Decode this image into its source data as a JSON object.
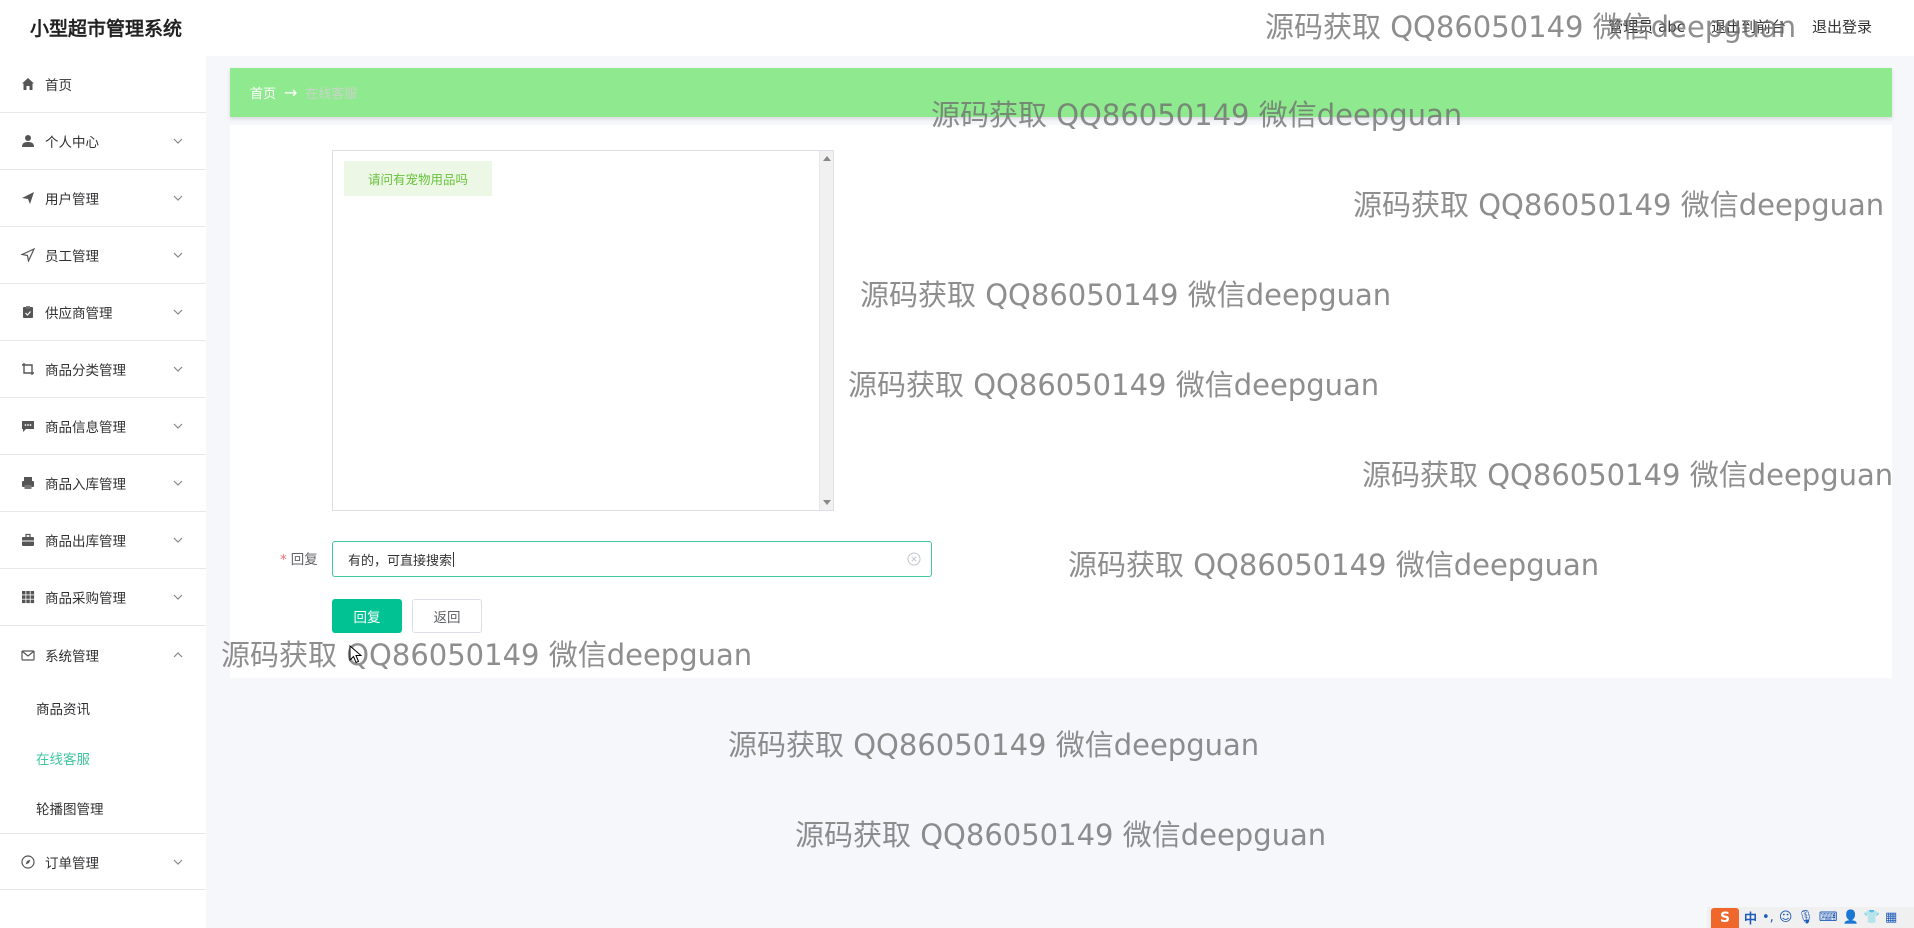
{
  "app": {
    "title": "小型超市管理系统"
  },
  "header": {
    "user_label": "管理员 abc",
    "back_to_front": "退出到前台",
    "logout": "退出登录"
  },
  "sidebar": {
    "items": [
      {
        "label": "首页",
        "icon": "home-icon",
        "has_children": false
      },
      {
        "label": "个人中心",
        "icon": "user-icon",
        "has_children": true
      },
      {
        "label": "用户管理",
        "icon": "send-icon",
        "has_children": true
      },
      {
        "label": "员工管理",
        "icon": "navigation-icon",
        "has_children": true
      },
      {
        "label": "供应商管理",
        "icon": "clipboard-icon",
        "has_children": true
      },
      {
        "label": "商品分类管理",
        "icon": "crop-icon",
        "has_children": true
      },
      {
        "label": "商品信息管理",
        "icon": "message-icon",
        "has_children": true
      },
      {
        "label": "商品入库管理",
        "icon": "printer-icon",
        "has_children": true
      },
      {
        "label": "商品出库管理",
        "icon": "briefcase-icon",
        "has_children": true
      },
      {
        "label": "商品采购管理",
        "icon": "grid-icon",
        "has_children": true
      },
      {
        "label": "系统管理",
        "icon": "mail-icon",
        "has_children": true,
        "expanded": true
      },
      {
        "label": "订单管理",
        "icon": "compass-icon",
        "has_children": true
      }
    ],
    "system_submenu": [
      {
        "label": "商品资讯",
        "active": false
      },
      {
        "label": "在线客服",
        "active": true
      },
      {
        "label": "轮播图管理",
        "active": false
      }
    ]
  },
  "breadcrumb": {
    "home": "首页",
    "arrow": "→",
    "current": "在线客服"
  },
  "chat": {
    "messages": [
      {
        "text": "请问有宠物用品吗"
      }
    ]
  },
  "form": {
    "reply_required_mark": "*",
    "reply_label": "回复",
    "reply_value": "有的，可直接搜索"
  },
  "buttons": {
    "reply": "回复",
    "back": "返回"
  },
  "watermark_text": "源码获取 QQ86050149 微信deepguan",
  "ime": {
    "logo": "S",
    "lang": "中"
  },
  "colors": {
    "accent": "#00c292",
    "active_menu": "#3fc79e",
    "breadcrumb_bg": "#8fe98f",
    "bubble_bg": "#edf7e6",
    "bubble_text": "#67c23a"
  }
}
